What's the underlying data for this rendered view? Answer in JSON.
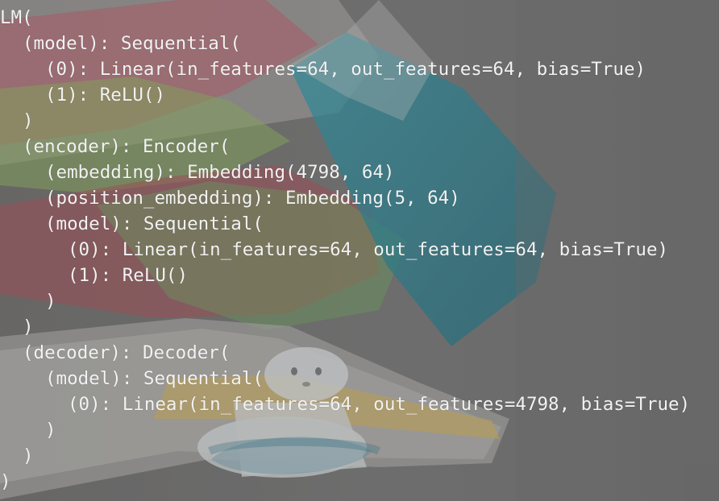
{
  "terminal": {
    "top_prompt_partial": "",
    "lines": [
      "LM(",
      "(model): Sequential(",
      "(0): Linear(in_features=64, out_features=64, bias=True)",
      "(1): ReLU()",
      ")",
      "(encoder): Encoder(",
      "(embedding): Embedding(4798, 64)",
      "(position_embedding): Embedding(5, 64)",
      "(model): Sequential(",
      "(0): Linear(in_features=64, out_features=64, bias=True)",
      "(1): ReLU()",
      ")",
      ")",
      "(decoder): Decoder(",
      "(model): Sequential(",
      "(0): Linear(in_features=64, out_features=4798, bias=True)",
      ")",
      ")",
      ")"
    ]
  }
}
